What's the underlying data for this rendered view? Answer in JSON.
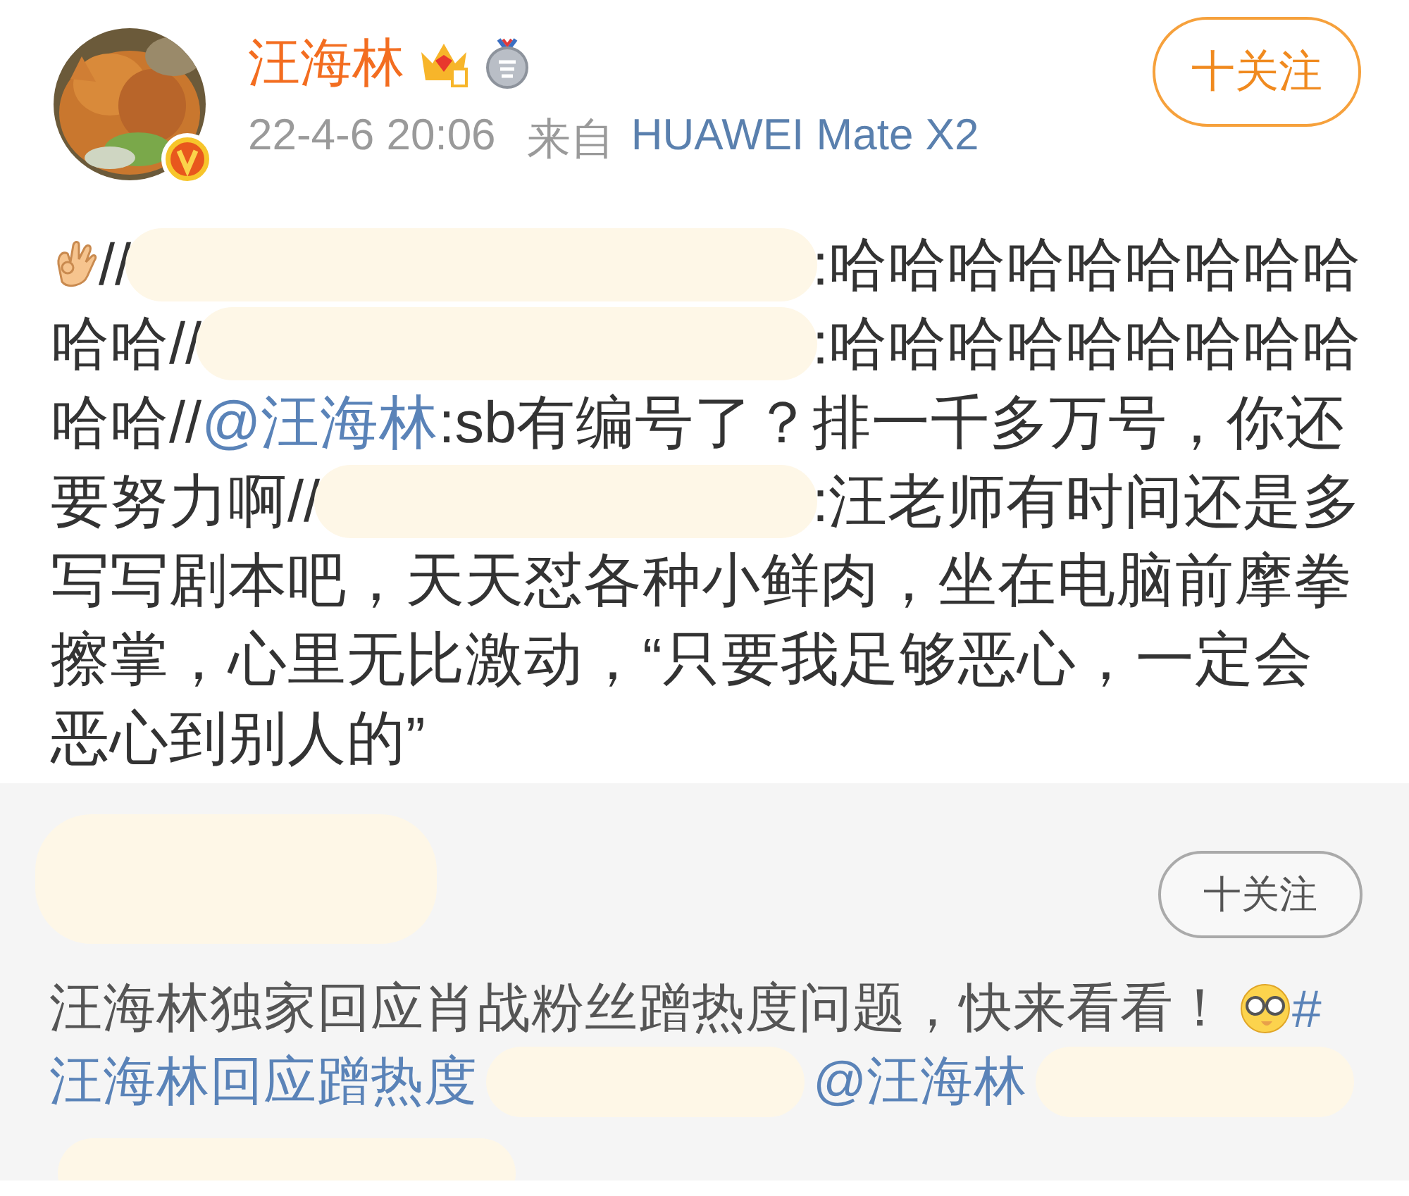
{
  "post": {
    "author": "汪海林",
    "time": "22-4-6 20:06",
    "source_label": "来自",
    "source": "HUAWEI Mate X2",
    "follow": "十关注",
    "lines": [
      [
        {
          "kind": "hand"
        },
        {
          "kind": "text",
          "text": "//"
        },
        {
          "kind": "redaction"
        },
        {
          "kind": "text",
          "text": ":哈哈哈哈哈哈哈哈哈"
        }
      ],
      [
        {
          "kind": "text",
          "text": "哈哈//"
        },
        {
          "kind": "redaction"
        },
        {
          "kind": "text",
          "text": ":哈哈哈哈哈哈哈哈哈"
        }
      ],
      [
        {
          "kind": "text",
          "text": "哈哈//"
        },
        {
          "kind": "mention",
          "text": "@汪海林"
        },
        {
          "kind": "text",
          "text": ":sb有编号了？排一千多万号，你还"
        }
      ],
      [
        {
          "kind": "text",
          "text": "要努力啊//"
        },
        {
          "kind": "redaction"
        },
        {
          "kind": "text",
          "text": ":汪老师有时间还是多"
        }
      ],
      [
        {
          "kind": "text",
          "text": "写写剧本吧，天天怼各种小鲜肉，坐在电脑前摩拳"
        }
      ],
      [
        {
          "kind": "text",
          "text": "擦掌，心里无比激动，“只要我足够恶心，一定会"
        }
      ],
      [
        {
          "kind": "text",
          "text": "恶心到别人的”"
        }
      ]
    ]
  },
  "repost": {
    "follow": "十关注",
    "lines": [
      [
        {
          "kind": "text",
          "text": "汪海林独家回应肖战粉丝蹭热度问题，快来看看！"
        },
        {
          "kind": "face"
        },
        {
          "kind": "mention",
          "text": "#"
        }
      ],
      [
        {
          "kind": "mention",
          "text": "汪海林回应蹭热度"
        },
        {
          "kind": "redaction"
        },
        {
          "kind": "mention",
          "text": "@汪海林"
        },
        {
          "kind": "redaction"
        }
      ],
      [
        {
          "kind": "redaction"
        }
      ]
    ]
  }
}
